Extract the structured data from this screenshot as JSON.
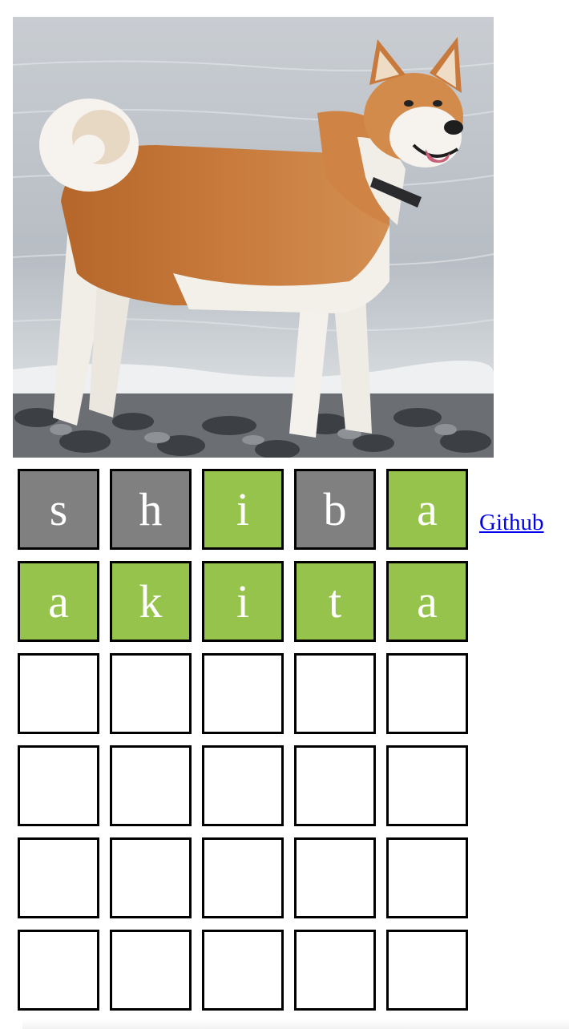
{
  "image": {
    "alt": "",
    "subject": "akita dog standing on pebbles by the sea"
  },
  "colors": {
    "absent": "#808080",
    "correct": "#96c34c",
    "empty": "#ffffff",
    "tile_border": "#000000",
    "letter": "#ffffff",
    "link": "#0000ee"
  },
  "board": {
    "rows": [
      {
        "tiles": [
          {
            "letter": "s",
            "state": "absent"
          },
          {
            "letter": "h",
            "state": "absent"
          },
          {
            "letter": "i",
            "state": "correct"
          },
          {
            "letter": "b",
            "state": "absent"
          },
          {
            "letter": "a",
            "state": "correct"
          }
        ]
      },
      {
        "tiles": [
          {
            "letter": "a",
            "state": "correct"
          },
          {
            "letter": "k",
            "state": "correct"
          },
          {
            "letter": "i",
            "state": "correct"
          },
          {
            "letter": "t",
            "state": "correct"
          },
          {
            "letter": "a",
            "state": "correct"
          }
        ]
      },
      {
        "tiles": [
          {
            "letter": "",
            "state": "empty"
          },
          {
            "letter": "",
            "state": "empty"
          },
          {
            "letter": "",
            "state": "empty"
          },
          {
            "letter": "",
            "state": "empty"
          },
          {
            "letter": "",
            "state": "empty"
          }
        ]
      },
      {
        "tiles": [
          {
            "letter": "",
            "state": "empty"
          },
          {
            "letter": "",
            "state": "empty"
          },
          {
            "letter": "",
            "state": "empty"
          },
          {
            "letter": "",
            "state": "empty"
          },
          {
            "letter": "",
            "state": "empty"
          }
        ]
      },
      {
        "tiles": [
          {
            "letter": "",
            "state": "empty"
          },
          {
            "letter": "",
            "state": "empty"
          },
          {
            "letter": "",
            "state": "empty"
          },
          {
            "letter": "",
            "state": "empty"
          },
          {
            "letter": "",
            "state": "empty"
          }
        ]
      },
      {
        "tiles": [
          {
            "letter": "",
            "state": "empty"
          },
          {
            "letter": "",
            "state": "empty"
          },
          {
            "letter": "",
            "state": "empty"
          },
          {
            "letter": "",
            "state": "empty"
          },
          {
            "letter": "",
            "state": "empty"
          }
        ]
      }
    ]
  },
  "links": {
    "github_label": "Github"
  }
}
